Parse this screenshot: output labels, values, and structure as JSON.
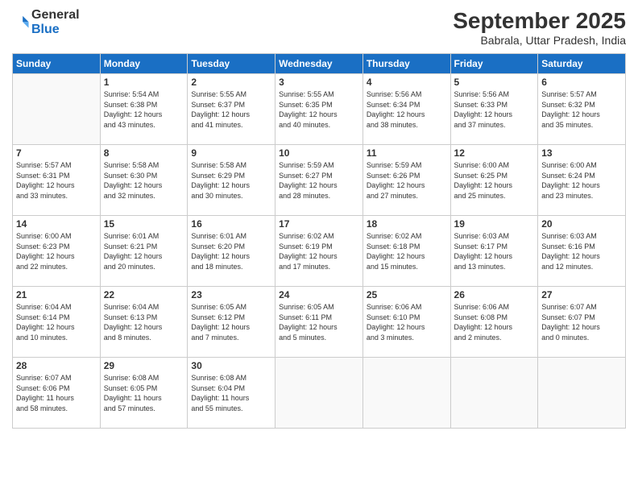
{
  "header": {
    "logo_line1": "General",
    "logo_line2": "Blue",
    "month": "September 2025",
    "location": "Babrala, Uttar Pradesh, India"
  },
  "weekdays": [
    "Sunday",
    "Monday",
    "Tuesday",
    "Wednesday",
    "Thursday",
    "Friday",
    "Saturday"
  ],
  "weeks": [
    [
      {
        "day": "",
        "info": ""
      },
      {
        "day": "1",
        "info": "Sunrise: 5:54 AM\nSunset: 6:38 PM\nDaylight: 12 hours\nand 43 minutes."
      },
      {
        "day": "2",
        "info": "Sunrise: 5:55 AM\nSunset: 6:37 PM\nDaylight: 12 hours\nand 41 minutes."
      },
      {
        "day": "3",
        "info": "Sunrise: 5:55 AM\nSunset: 6:35 PM\nDaylight: 12 hours\nand 40 minutes."
      },
      {
        "day": "4",
        "info": "Sunrise: 5:56 AM\nSunset: 6:34 PM\nDaylight: 12 hours\nand 38 minutes."
      },
      {
        "day": "5",
        "info": "Sunrise: 5:56 AM\nSunset: 6:33 PM\nDaylight: 12 hours\nand 37 minutes."
      },
      {
        "day": "6",
        "info": "Sunrise: 5:57 AM\nSunset: 6:32 PM\nDaylight: 12 hours\nand 35 minutes."
      }
    ],
    [
      {
        "day": "7",
        "info": "Sunrise: 5:57 AM\nSunset: 6:31 PM\nDaylight: 12 hours\nand 33 minutes."
      },
      {
        "day": "8",
        "info": "Sunrise: 5:58 AM\nSunset: 6:30 PM\nDaylight: 12 hours\nand 32 minutes."
      },
      {
        "day": "9",
        "info": "Sunrise: 5:58 AM\nSunset: 6:29 PM\nDaylight: 12 hours\nand 30 minutes."
      },
      {
        "day": "10",
        "info": "Sunrise: 5:59 AM\nSunset: 6:27 PM\nDaylight: 12 hours\nand 28 minutes."
      },
      {
        "day": "11",
        "info": "Sunrise: 5:59 AM\nSunset: 6:26 PM\nDaylight: 12 hours\nand 27 minutes."
      },
      {
        "day": "12",
        "info": "Sunrise: 6:00 AM\nSunset: 6:25 PM\nDaylight: 12 hours\nand 25 minutes."
      },
      {
        "day": "13",
        "info": "Sunrise: 6:00 AM\nSunset: 6:24 PM\nDaylight: 12 hours\nand 23 minutes."
      }
    ],
    [
      {
        "day": "14",
        "info": "Sunrise: 6:00 AM\nSunset: 6:23 PM\nDaylight: 12 hours\nand 22 minutes."
      },
      {
        "day": "15",
        "info": "Sunrise: 6:01 AM\nSunset: 6:21 PM\nDaylight: 12 hours\nand 20 minutes."
      },
      {
        "day": "16",
        "info": "Sunrise: 6:01 AM\nSunset: 6:20 PM\nDaylight: 12 hours\nand 18 minutes."
      },
      {
        "day": "17",
        "info": "Sunrise: 6:02 AM\nSunset: 6:19 PM\nDaylight: 12 hours\nand 17 minutes."
      },
      {
        "day": "18",
        "info": "Sunrise: 6:02 AM\nSunset: 6:18 PM\nDaylight: 12 hours\nand 15 minutes."
      },
      {
        "day": "19",
        "info": "Sunrise: 6:03 AM\nSunset: 6:17 PM\nDaylight: 12 hours\nand 13 minutes."
      },
      {
        "day": "20",
        "info": "Sunrise: 6:03 AM\nSunset: 6:16 PM\nDaylight: 12 hours\nand 12 minutes."
      }
    ],
    [
      {
        "day": "21",
        "info": "Sunrise: 6:04 AM\nSunset: 6:14 PM\nDaylight: 12 hours\nand 10 minutes."
      },
      {
        "day": "22",
        "info": "Sunrise: 6:04 AM\nSunset: 6:13 PM\nDaylight: 12 hours\nand 8 minutes."
      },
      {
        "day": "23",
        "info": "Sunrise: 6:05 AM\nSunset: 6:12 PM\nDaylight: 12 hours\nand 7 minutes."
      },
      {
        "day": "24",
        "info": "Sunrise: 6:05 AM\nSunset: 6:11 PM\nDaylight: 12 hours\nand 5 minutes."
      },
      {
        "day": "25",
        "info": "Sunrise: 6:06 AM\nSunset: 6:10 PM\nDaylight: 12 hours\nand 3 minutes."
      },
      {
        "day": "26",
        "info": "Sunrise: 6:06 AM\nSunset: 6:08 PM\nDaylight: 12 hours\nand 2 minutes."
      },
      {
        "day": "27",
        "info": "Sunrise: 6:07 AM\nSunset: 6:07 PM\nDaylight: 12 hours\nand 0 minutes."
      }
    ],
    [
      {
        "day": "28",
        "info": "Sunrise: 6:07 AM\nSunset: 6:06 PM\nDaylight: 11 hours\nand 58 minutes."
      },
      {
        "day": "29",
        "info": "Sunrise: 6:08 AM\nSunset: 6:05 PM\nDaylight: 11 hours\nand 57 minutes."
      },
      {
        "day": "30",
        "info": "Sunrise: 6:08 AM\nSunset: 6:04 PM\nDaylight: 11 hours\nand 55 minutes."
      },
      {
        "day": "",
        "info": ""
      },
      {
        "day": "",
        "info": ""
      },
      {
        "day": "",
        "info": ""
      },
      {
        "day": "",
        "info": ""
      }
    ]
  ]
}
